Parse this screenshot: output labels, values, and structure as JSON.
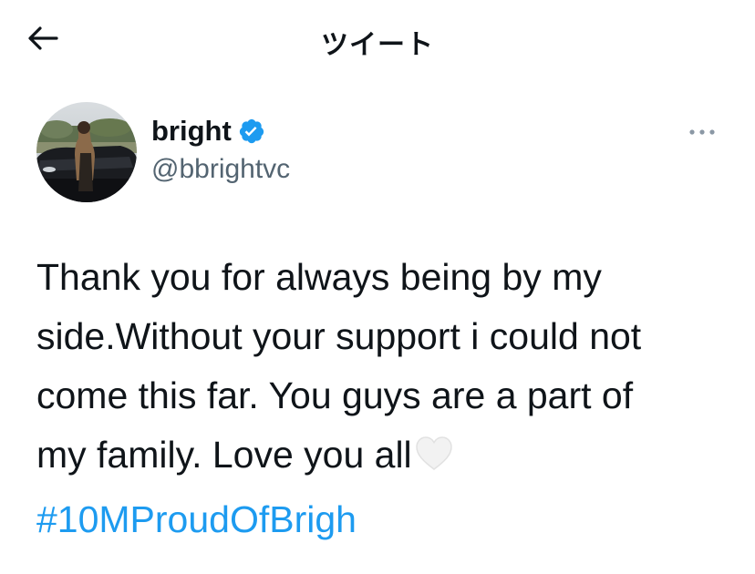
{
  "header": {
    "title": "ツイート",
    "back_icon": "arrow-left-icon"
  },
  "author": {
    "name": "bright",
    "handle": "@bbrightvc",
    "verified": true,
    "verified_icon": "verified-badge-icon",
    "badge_color": "#1d9bf0"
  },
  "more_icon": "more-options-icon",
  "tweet": {
    "lines": [
      "Thank you for always being by my",
      "side.Without your support i could not",
      "come this far. You guys are a part of",
      "my family. Love you all"
    ],
    "emoji": "white-heart-icon",
    "hashtag": "#10MProudOfBrigh",
    "hashtag_color": "#1d9bf0"
  }
}
